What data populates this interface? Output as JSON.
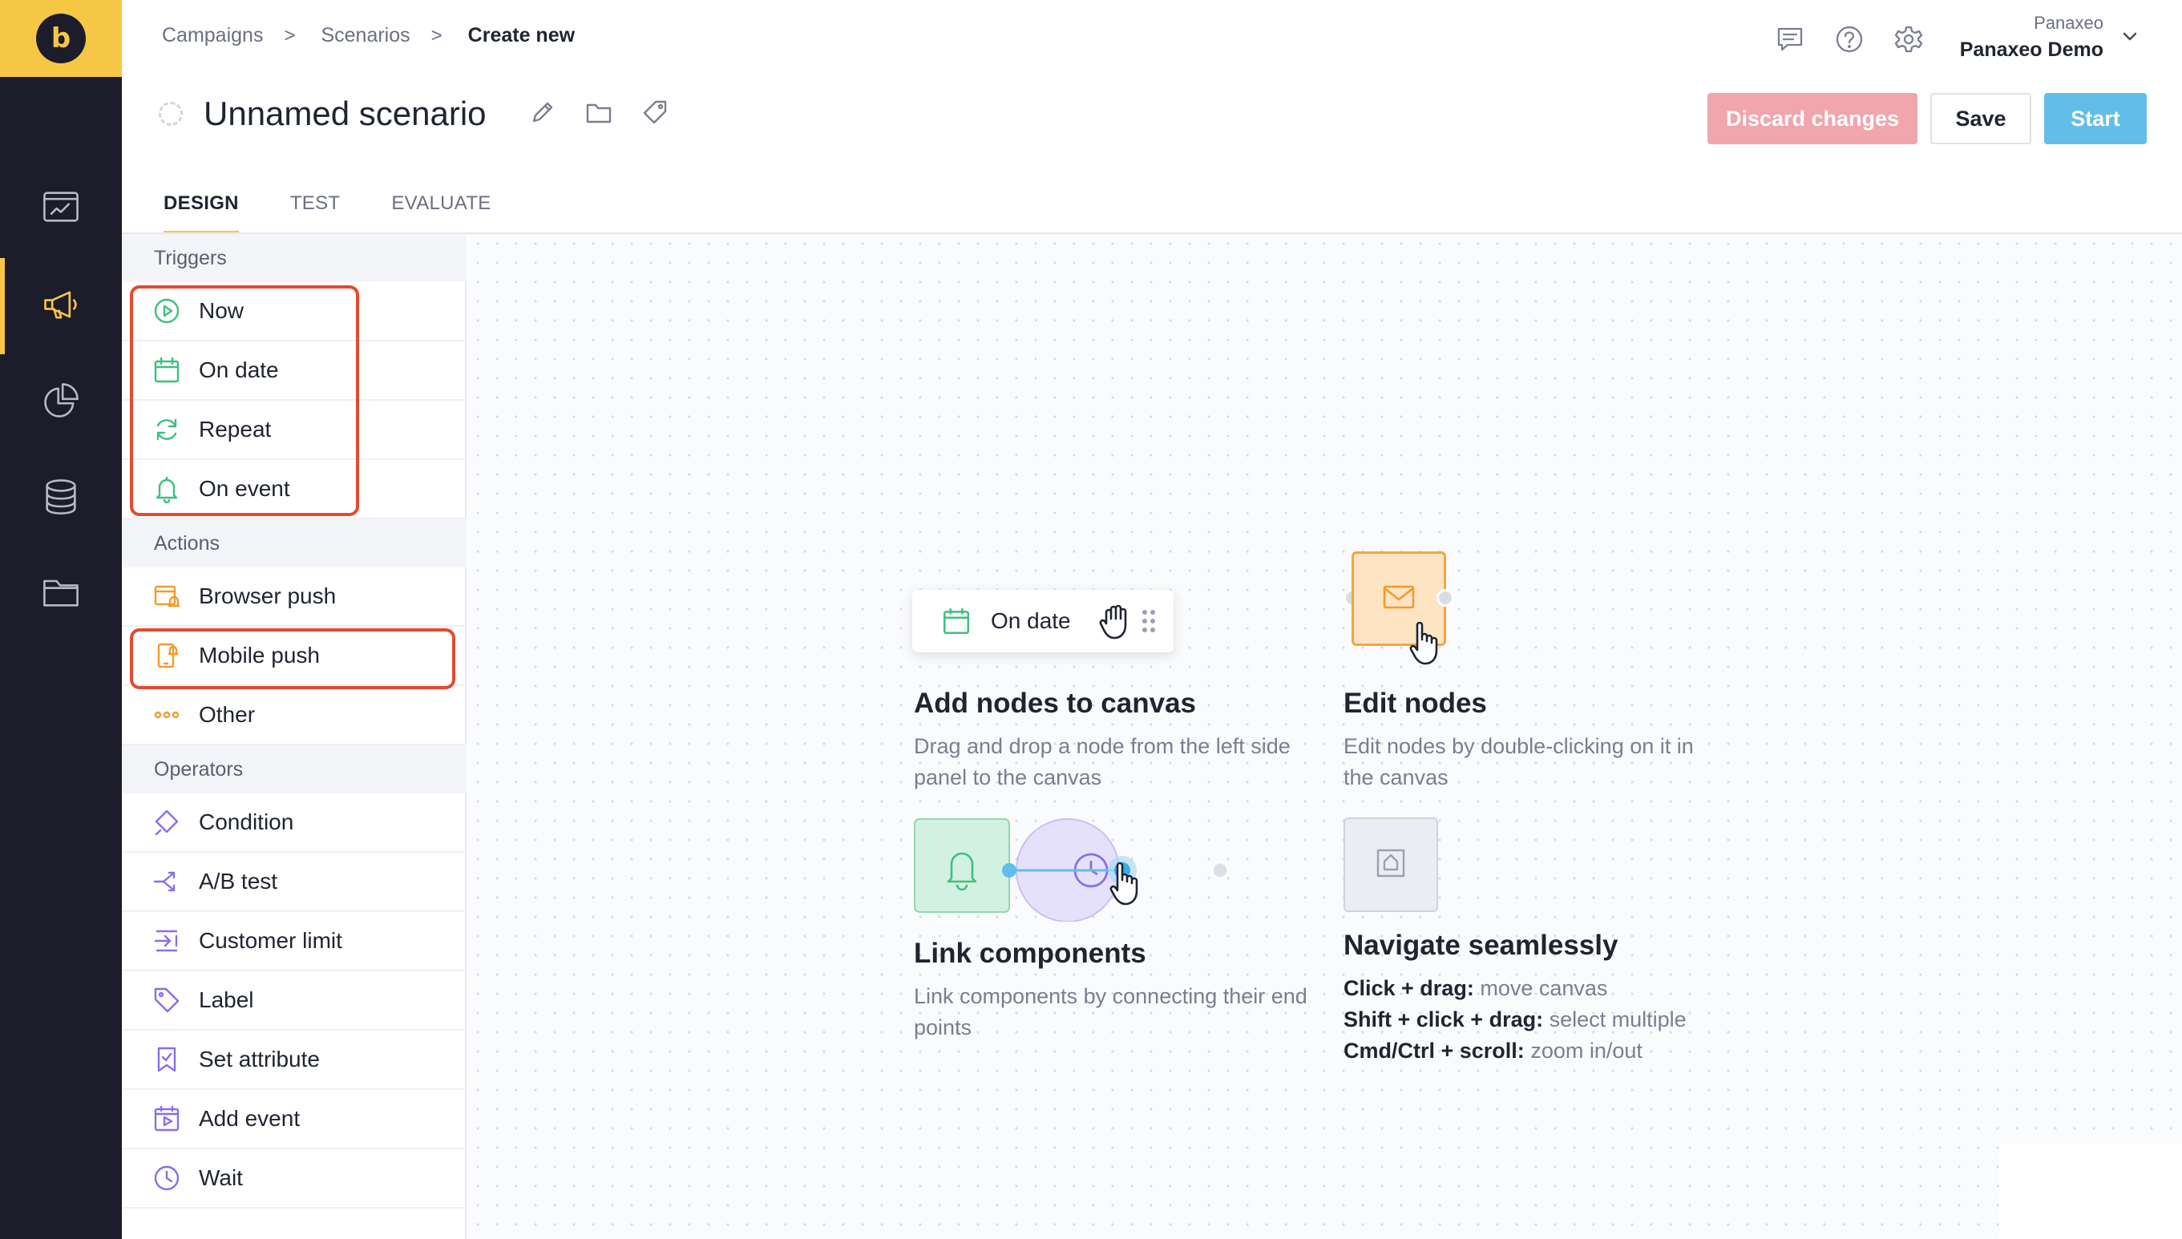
{
  "app": {
    "logo_letter": "b",
    "brand_color": "#f6c744",
    "rail_color": "#1c1c2b"
  },
  "rail": {
    "items": [
      {
        "icon": "dashboard-icon"
      },
      {
        "icon": "megaphone-icon",
        "active": true
      },
      {
        "icon": "pie-chart-icon"
      },
      {
        "icon": "database-icon"
      },
      {
        "icon": "folder-icon"
      }
    ]
  },
  "breadcrumb": {
    "items": [
      "Campaigns",
      "Scenarios"
    ],
    "current": "Create new",
    "separator": ">"
  },
  "scenario": {
    "title": "Unnamed scenario"
  },
  "header": {
    "icons": [
      "chat-icon",
      "help-icon",
      "settings-icon"
    ],
    "account": {
      "org": "Panaxeo",
      "name": "Panaxeo Demo"
    }
  },
  "actions": {
    "discard": "Discard changes",
    "save": "Save",
    "start": "Start",
    "colors": {
      "discard": "#f1a5ad",
      "start": "#62bde9"
    }
  },
  "tabs": [
    {
      "label": "DESIGN",
      "active": true
    },
    {
      "label": "TEST"
    },
    {
      "label": "EVALUATE"
    }
  ],
  "panel": {
    "triggers": {
      "heading": "Triggers",
      "items": [
        {
          "label": "Now",
          "icon": "play-circle-icon"
        },
        {
          "label": "On date",
          "icon": "calendar-icon"
        },
        {
          "label": "Repeat",
          "icon": "repeat-icon"
        },
        {
          "label": "On event",
          "icon": "bell-icon"
        }
      ]
    },
    "actions": {
      "heading": "Actions",
      "items": [
        {
          "label": "Browser push",
          "icon": "browser-push-icon"
        },
        {
          "label": "Mobile push",
          "icon": "mobile-push-icon"
        },
        {
          "label": "Other",
          "icon": "more-dots-icon"
        }
      ]
    },
    "operators": {
      "heading": "Operators",
      "items": [
        {
          "label": "Condition",
          "icon": "condition-icon"
        },
        {
          "label": "A/B test",
          "icon": "split-icon"
        },
        {
          "label": "Customer limit",
          "icon": "limit-icon"
        },
        {
          "label": "Label",
          "icon": "tag-icon"
        },
        {
          "label": "Set attribute",
          "icon": "bookmark-check-icon"
        },
        {
          "label": "Add event",
          "icon": "add-event-icon"
        },
        {
          "label": "Wait",
          "icon": "clock-icon"
        }
      ]
    },
    "annotation_color": "#e34a31"
  },
  "canvas": {
    "demo_node": {
      "label": "On date",
      "icon": "calendar-icon"
    },
    "help": {
      "add": {
        "title": "Add nodes to canvas",
        "text": "Drag and drop a node from the left side panel to the canvas"
      },
      "edit": {
        "title": "Edit nodes",
        "text": "Edit nodes by double-clicking on it in the canvas"
      },
      "link": {
        "title": "Link components",
        "text": "Link components by connecting their end points"
      },
      "navigate": {
        "title": "Navigate seamlessly",
        "lines": [
          {
            "key": "Click + drag:",
            "desc": "move canvas"
          },
          {
            "key": "Shift + click + drag:",
            "desc": "select multiple"
          },
          {
            "key": "Cmd/Ctrl + scroll:",
            "desc": "zoom in/out"
          }
        ]
      }
    }
  }
}
